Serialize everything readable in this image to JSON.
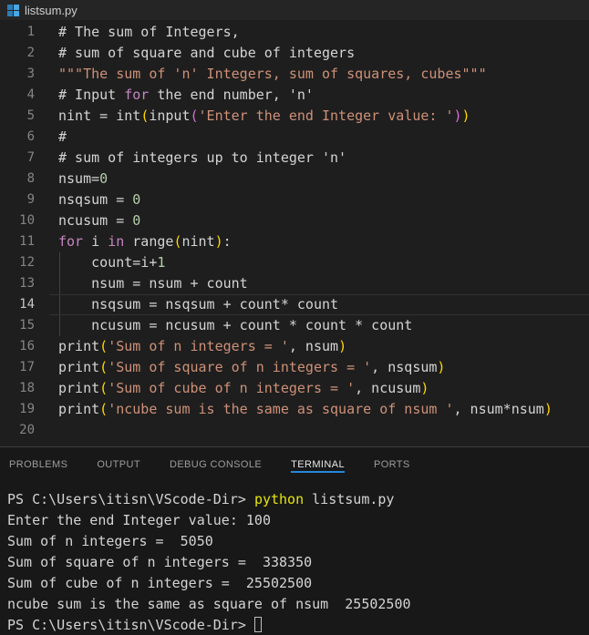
{
  "title_bar": {
    "filename": "listsum.py",
    "icon": "python-file-icon"
  },
  "colors": {
    "editor_bg": "#1e1e1e",
    "panel_bg": "#181818",
    "titlebar_bg": "#252526",
    "keyword": "#c586c0",
    "string": "#ce9178",
    "number": "#b5cea8",
    "bracket_level1": "#ffd700",
    "bracket_level2": "#da70d6",
    "tab_underline_accent": "#2488db",
    "terminal_command_yellow": "#e5e510",
    "file_icon_blue": "#4aa7e4"
  },
  "editor": {
    "active_line": 14,
    "lines": [
      {
        "num": 1,
        "guide": false,
        "tokens": [
          [
            "# The sum of Integers,",
            "default"
          ]
        ]
      },
      {
        "num": 2,
        "guide": false,
        "tokens": [
          [
            "# sum of square and cube of integers",
            "default"
          ]
        ]
      },
      {
        "num": 3,
        "guide": false,
        "tokens": [
          [
            "\"\"\"The sum of 'n' Integers, sum of squares, cubes\"\"\"",
            "string"
          ]
        ]
      },
      {
        "num": 4,
        "guide": false,
        "tokens": [
          [
            "# Input ",
            "default"
          ],
          [
            "for",
            "keyword"
          ],
          [
            " the end number, 'n'",
            "default"
          ]
        ]
      },
      {
        "num": 5,
        "guide": false,
        "tokens": [
          [
            "nint = int",
            "default"
          ],
          [
            "(",
            "paren1"
          ],
          [
            "input",
            "default"
          ],
          [
            "(",
            "paren2"
          ],
          [
            "'Enter the end Integer value: '",
            "string"
          ],
          [
            ")",
            "paren2"
          ],
          [
            ")",
            "paren1"
          ]
        ]
      },
      {
        "num": 6,
        "guide": false,
        "tokens": [
          [
            "#",
            "default"
          ]
        ]
      },
      {
        "num": 7,
        "guide": false,
        "tokens": [
          [
            "# sum of integers up to integer 'n'",
            "default"
          ]
        ]
      },
      {
        "num": 8,
        "guide": false,
        "tokens": [
          [
            "nsum=",
            "default"
          ],
          [
            "0",
            "number"
          ]
        ]
      },
      {
        "num": 9,
        "guide": false,
        "tokens": [
          [
            "nsqsum = ",
            "default"
          ],
          [
            "0",
            "number"
          ]
        ]
      },
      {
        "num": 10,
        "guide": false,
        "tokens": [
          [
            "ncusum = ",
            "default"
          ],
          [
            "0",
            "number"
          ]
        ]
      },
      {
        "num": 11,
        "guide": false,
        "tokens": [
          [
            "for",
            "keyword"
          ],
          [
            " i ",
            "default"
          ],
          [
            "in",
            "keyword"
          ],
          [
            " range",
            "default"
          ],
          [
            "(",
            "paren1"
          ],
          [
            "nint",
            "default"
          ],
          [
            ")",
            "paren1"
          ],
          [
            ":",
            "default"
          ]
        ]
      },
      {
        "num": 12,
        "guide": true,
        "tokens": [
          [
            "    count=i+",
            "default"
          ],
          [
            "1",
            "number"
          ]
        ]
      },
      {
        "num": 13,
        "guide": true,
        "tokens": [
          [
            "    nsum = nsum + count",
            "default"
          ]
        ]
      },
      {
        "num": 14,
        "guide": true,
        "tokens": [
          [
            "    nsqsum = nsqsum + count* count",
            "default"
          ]
        ]
      },
      {
        "num": 15,
        "guide": true,
        "tokens": [
          [
            "    ncusum = ncusum + count * count * count",
            "default"
          ]
        ]
      },
      {
        "num": 16,
        "guide": false,
        "tokens": [
          [
            "print",
            "default"
          ],
          [
            "(",
            "paren1"
          ],
          [
            "'Sum of n integers = '",
            "string"
          ],
          [
            ", nsum",
            "default"
          ],
          [
            ")",
            "paren1"
          ]
        ]
      },
      {
        "num": 17,
        "guide": false,
        "tokens": [
          [
            "print",
            "default"
          ],
          [
            "(",
            "paren1"
          ],
          [
            "'Sum of square of n integers = '",
            "string"
          ],
          [
            ", nsqsum",
            "default"
          ],
          [
            ")",
            "paren1"
          ]
        ]
      },
      {
        "num": 18,
        "guide": false,
        "tokens": [
          [
            "print",
            "default"
          ],
          [
            "(",
            "paren1"
          ],
          [
            "'Sum of cube of n integers = '",
            "string"
          ],
          [
            ", ncusum",
            "default"
          ],
          [
            ")",
            "paren1"
          ]
        ]
      },
      {
        "num": 19,
        "guide": false,
        "tokens": [
          [
            "print",
            "default"
          ],
          [
            "(",
            "paren1"
          ],
          [
            "'ncube sum is the same as square of nsum '",
            "string"
          ],
          [
            ", nsum*nsum",
            "default"
          ],
          [
            ")",
            "paren1"
          ]
        ]
      },
      {
        "num": 20,
        "guide": false,
        "tokens": []
      }
    ]
  },
  "panel": {
    "tabs": [
      {
        "label": "PROBLEMS",
        "active": false
      },
      {
        "label": "OUTPUT",
        "active": false
      },
      {
        "label": "DEBUG CONSOLE",
        "active": false
      },
      {
        "label": "TERMINAL",
        "active": true
      },
      {
        "label": "PORTS",
        "active": false
      }
    ]
  },
  "terminal": {
    "lines": [
      {
        "cursor": false,
        "tokens": [
          [
            "PS C:\\Users\\itisn\\VScode-Dir> ",
            "default"
          ],
          [
            "python",
            "term-yellow"
          ],
          [
            " listsum.py",
            "default"
          ]
        ]
      },
      {
        "cursor": false,
        "tokens": [
          [
            "Enter the end Integer value: 100",
            "default"
          ]
        ]
      },
      {
        "cursor": false,
        "tokens": [
          [
            "Sum of n integers =  5050",
            "default"
          ]
        ]
      },
      {
        "cursor": false,
        "tokens": [
          [
            "Sum of square of n integers =  338350",
            "default"
          ]
        ]
      },
      {
        "cursor": false,
        "tokens": [
          [
            "Sum of cube of n integers =  25502500",
            "default"
          ]
        ]
      },
      {
        "cursor": false,
        "tokens": [
          [
            "ncube sum is the same as square of nsum  25502500",
            "default"
          ]
        ]
      },
      {
        "cursor": true,
        "tokens": [
          [
            "PS C:\\Users\\itisn\\VScode-Dir> ",
            "default"
          ]
        ]
      }
    ]
  }
}
